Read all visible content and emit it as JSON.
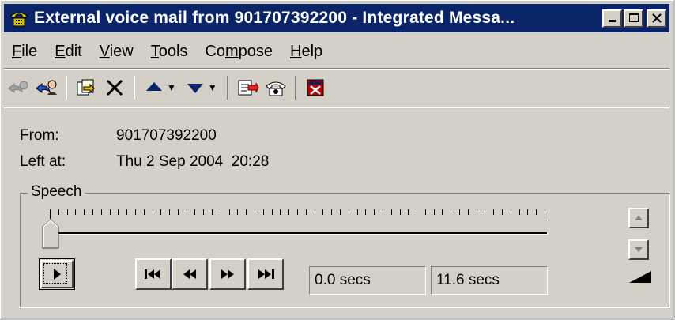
{
  "window": {
    "title": "External voice mail from 901707392200 - Integrated Messa...",
    "controls": [
      "minimize",
      "maximize",
      "close"
    ]
  },
  "menu": {
    "items": [
      {
        "label": "File",
        "mnemonic_index": 0
      },
      {
        "label": "Edit",
        "mnemonic_index": 0
      },
      {
        "label": "View",
        "mnemonic_index": 0
      },
      {
        "label": "Tools",
        "mnemonic_index": 0
      },
      {
        "label": "Compose",
        "mnemonic_index": 2
      },
      {
        "label": "Help",
        "mnemonic_index": 0
      }
    ]
  },
  "toolbar": {
    "icons": [
      "reply-disabled-icon",
      "reply-all-icon",
      "forward-icon",
      "delete-icon",
      "previous-message-icon",
      "next-message-icon",
      "message-properties-icon",
      "telephone-icon",
      "close-window-icon"
    ]
  },
  "message": {
    "from_label": "From:",
    "from_value": "901707392200",
    "left_label": "Left at:",
    "left_value": "Thu 2 Sep 2004  20:28"
  },
  "speech": {
    "group_label": "Speech",
    "position_fraction": 0.0,
    "position_text": "0.0 secs",
    "duration_text": "11.6 secs"
  },
  "colors": {
    "titlebar": "#0a246a",
    "face": "#d4d0c8"
  }
}
